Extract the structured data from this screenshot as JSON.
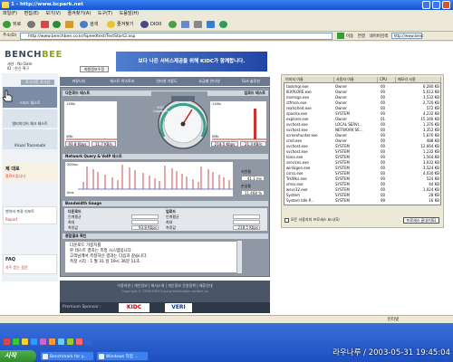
{
  "window": {
    "title": "1 - http://www.bcpark.net"
  },
  "menu": [
    "파일(F)",
    "편집(E)",
    "보기(V)",
    "즐겨찾기(A)",
    "도구(T)",
    "도움말(H)"
  ],
  "toolbar": {
    "back": "뒤로",
    "search": "검색",
    "favorites": "즐겨찾기",
    "media": "DIOII"
  },
  "address": {
    "label": "주소(D)",
    "url": "http://www.benchbee.co.kr/Speedtest/TestStart2.asp",
    "go": "이동",
    "links": "연결",
    "search_label": "네이버검색",
    "search_value": "http://www.benc"
  },
  "site": {
    "logo_main": "BENCH",
    "logo_accent": "BEE",
    "user_line1": "세션 : No Date",
    "user_line2": "ID : 한신 웍구",
    "account_btn": "회원정보수정",
    "banner": "보다 나은 서비스제공을 위해 KIDC가 함께합니다.",
    "login_btn": "로그아웃 로그인",
    "speed_btn": "스피드 테스트",
    "nav_card1": "멀티미디어 체크 테스트",
    "nav_card2": "Visual Traceroute",
    "help_title": "제 대로",
    "help_sub": "알려드립니다",
    "report": "벤치비 측정 리포트",
    "report_sub": "Report",
    "faq": "FAQ",
    "faq_sub": "자주 묻는 질문"
  },
  "tabs": [
    "커뮤니티",
    "테스트 히스토리",
    "인터넷 가동도",
    "요금제 인터넷",
    "SLA 솔루션"
  ],
  "speed": {
    "header": "다운로드 테스트",
    "header_right": "업로드 테스트",
    "dl_top": "11Mb",
    "dl_bottom": "0Mb",
    "dl_kbps": "93.8 Kbps",
    "dl_kbs": "11.7 KB/s",
    "ul_top": "11Mb",
    "ul_bottom": "0Mb",
    "ul_kbps": "218.5 Kbps",
    "ul_kbs": "21.3 KB/s",
    "vod_label": "VOD Capability"
  },
  "network": {
    "header": "Network Query & VoIP 테스트",
    "top": "300ms",
    "bottom": "0ms",
    "latency_label": "지연율",
    "latency": "41.1 ms",
    "loss_label": "손실율",
    "loss": "11.468 %"
  },
  "bandwidth": {
    "header": "Bandwidth Gauge",
    "download": "다운로드",
    "upload": "업로드",
    "row1": "인계평균",
    "row2": "최대",
    "row3": "측정값",
    "dl_value": "93.8 Kbps",
    "ul_value": "218.5 Kbps"
  },
  "log": {
    "header": "종합결과 확인",
    "line1": "다운로드 가중치를",
    "line2": "본 테스트 결과는 측정 시스템입니다.",
    "line3": "고객님께서 측정하신 결과는 다음과 같습니다.",
    "line4": "",
    "line5": "측정 시각 :  1 월 31 일  19시 36분 11초"
  },
  "footer": {
    "links": "이용약관  |  개인정보  |  회사소개  |  개인정보 운영정책  |  제휴안내",
    "copy": "Copyright © 1999-2003 Insung Information  contact us",
    "sponsor": "Premium Sponsor :",
    "kidc": "KIDC",
    "veri": "VERI"
  },
  "taskmgr": {
    "cols": [
      "이미지 이름",
      "사용자 이름",
      "CPU",
      "메모리 사용"
    ],
    "rows": [
      [
        "taskmgr.exe",
        "Owner",
        "00",
        "6,280 KB"
      ],
      [
        "IEXPLORE.exe",
        "Owner",
        "00",
        "5,612 KB"
      ],
      [
        "msmsgs.exe",
        "Owner",
        "00",
        "3,532 KB"
      ],
      [
        "ctfmon.exe",
        "Owner",
        "00",
        "2,720 KB"
      ],
      [
        "realsched.exe",
        "Owner",
        "00",
        "572 KB"
      ],
      [
        "spoolsv.exe",
        "SYSTEM",
        "00",
        "4,232 KB"
      ],
      [
        "explorer.exe",
        "Owner",
        "01",
        "15,340 KB"
      ],
      [
        "svchost.exe",
        "LOCAL SERVI...",
        "00",
        "1,376 KB"
      ],
      [
        "svchost.exe",
        "NETWORK SE...",
        "00",
        "3,352 KB"
      ],
      [
        "screenhunter.exe",
        "Owner",
        "00",
        "5,676 KB"
      ],
      [
        "cmd.exe",
        "Owner",
        "00",
        "488 KB"
      ],
      [
        "svchost.exe",
        "SYSTEM",
        "00",
        "12,664 KB"
      ],
      [
        "svchost.exe",
        "SYSTEM",
        "00",
        "1,232 KB"
      ],
      [
        "lsass.exe",
        "SYSTEM",
        "00",
        "1,564 KB"
      ],
      [
        "services.exe",
        "SYSTEM",
        "00",
        "3,032 KB"
      ],
      [
        "winlogon.exe",
        "SYSTEM",
        "00",
        "3,524 KB"
      ],
      [
        "csrss.exe",
        "SYSTEM",
        "00",
        "4,030 KB"
      ],
      [
        "TrkWks.exe",
        "SYSTEM",
        "00",
        "524 KB"
      ],
      [
        "smss.exe",
        "SYSTEM",
        "00",
        "44 KB"
      ],
      [
        "wsvc32.exe",
        "SYSTEM",
        "00",
        "1,024 KB"
      ],
      [
        "System",
        "SYSTEM",
        "00",
        "28 KB"
      ],
      [
        "System Idle P...",
        "SYSTEM",
        "99",
        "16 KB"
      ]
    ],
    "checkbox": "모든 사용자의 프로세스 표시(S)",
    "end_btn": "프로세스 끝내기(E)"
  },
  "statusbar": {
    "left": "",
    "right": "인터넷"
  },
  "taskbar": {
    "start": "시작",
    "items": [
      "Benchmark for y...",
      "Windows 작업 ..."
    ],
    "clock": "라우나루 / 2003-05-31 19:45:04"
  }
}
